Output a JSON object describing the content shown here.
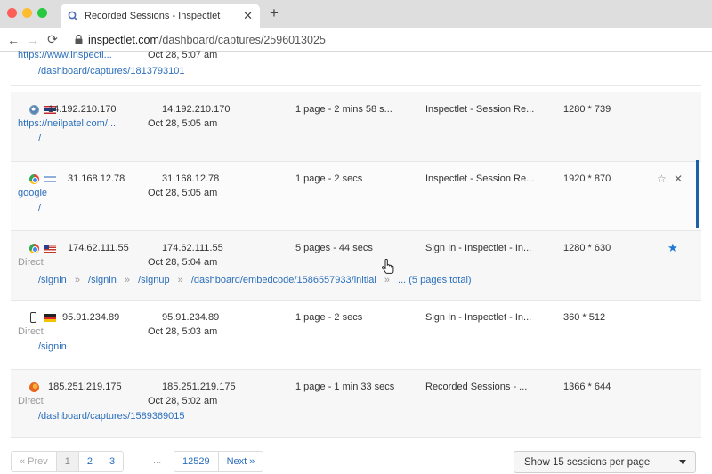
{
  "browser": {
    "tab_title": "Recorded Sessions - Inspectlet",
    "url_host": "inspectlet.com",
    "url_path": "/dashboard/captures/2596013025"
  },
  "top_partial": {
    "referrer": "https://www.inspecti...",
    "date": "Oct 28, 5:07 am",
    "path": "/dashboard/captures/1813793101"
  },
  "sessions": [
    {
      "ip": "14.192.210.170",
      "ip_repeat": "14.192.210.170",
      "source": "https://neilpatel.com/...",
      "date": "Oct 28, 5:05 am",
      "pages": "1 page - 2 mins 58 s...",
      "title": "Inspectlet - Session Re...",
      "resolution": "1280 * 739",
      "path": "/",
      "browser_icon": "safari-icon",
      "flag": "thailand-flag-icon"
    },
    {
      "ip": "31.168.12.78",
      "ip_repeat": "31.168.12.78",
      "source": "google",
      "date": "Oct 28, 5:05 am",
      "pages": "1 page - 2 secs",
      "title": "Inspectlet - Session Re...",
      "resolution": "1920 * 870",
      "path": "/",
      "browser_icon": "chrome-icon",
      "flag": "israel-flag-icon"
    },
    {
      "ip": "174.62.111.55",
      "ip_repeat": "174.62.111.55",
      "source": "Direct",
      "date": "Oct 28, 5:04 am",
      "pages": "5 pages - 44 secs",
      "title": "Sign In - Inspectlet - In...",
      "resolution": "1280 * 630",
      "browser_icon": "chrome-icon",
      "flag": "usa-flag-icon",
      "path_steps": [
        "/signin",
        "/signin",
        "/signup",
        "/dashboard/embedcode/1586557933/initial",
        "... (5 pages total)"
      ],
      "separator": "»"
    },
    {
      "ip": "95.91.234.89",
      "ip_repeat": "95.91.234.89",
      "source": "Direct",
      "date": "Oct 28, 5:03 am",
      "pages": "1 page - 2 secs",
      "title": "Sign In - Inspectlet - In...",
      "resolution": "360 * 512",
      "path": "/signin",
      "browser_icon": "mobile-phone-icon",
      "flag": "germany-flag-icon"
    },
    {
      "ip": "185.251.219.175",
      "ip_repeat": "185.251.219.175",
      "source": "Direct",
      "date": "Oct 28, 5:02 am",
      "pages": "1 page - 1 min 33 secs",
      "title": "Recorded Sessions - ...",
      "resolution": "1366 * 644",
      "path": "/dashboard/captures/1589369015",
      "browser_icon": "firefox-icon"
    }
  ],
  "pagination": {
    "prev": "« Prev",
    "pages": [
      "1",
      "2",
      "3"
    ],
    "ellipsis": "...",
    "last": "12529",
    "next": "Next »",
    "current": "1"
  },
  "per_page": {
    "label": "Show 15 sessions per page"
  },
  "colors": {
    "link": "#2a6ebb",
    "accent": "#1e7bd6",
    "scroll_marker": "#1e5fa8"
  }
}
